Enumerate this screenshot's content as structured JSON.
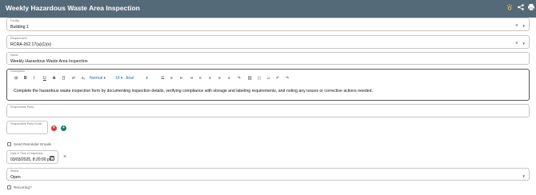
{
  "header": {
    "title": "Weekly Hazardous Waste Area Inspection",
    "icons": [
      "lightbulb-icon",
      "share-icon",
      "print-icon"
    ]
  },
  "facility": {
    "label": "Facility",
    "value": "Building 1"
  },
  "requirement": {
    "label": "Requirement",
    "value": "RCRA-262.17(a)(1)(v)"
  },
  "name": {
    "label": "Name",
    "value": "Weekly Hazardous Waste Area Inspection"
  },
  "description": {
    "label": "Description",
    "font_format": "Normal",
    "font_size": "14",
    "font_family": "Arial",
    "content": "Complete the hazardous waste inspection form by documenting inspection details, verifying compliance with storage and labeling requirements, and noting any issues or corrective actions needed."
  },
  "responsible_party": {
    "label": "Responsible Party",
    "value": ""
  },
  "responsible_party_email": {
    "label": "Responsible Party Email",
    "value": ""
  },
  "send_reminder": {
    "label": "Send Reminder Emails",
    "checked": false
  },
  "inspection_date": {
    "label": "Date & Time of Inspection",
    "value": "03/03/2025, 8:20:00 pm"
  },
  "status": {
    "label": "Status",
    "value": "Open"
  },
  "recurring": {
    "label": "Recurring?",
    "checked": false
  },
  "colors": {
    "header_bg": "#546a78",
    "remove": "#d33a3a",
    "add": "#1f7a6a",
    "link_blue": "#2a6fb6"
  }
}
